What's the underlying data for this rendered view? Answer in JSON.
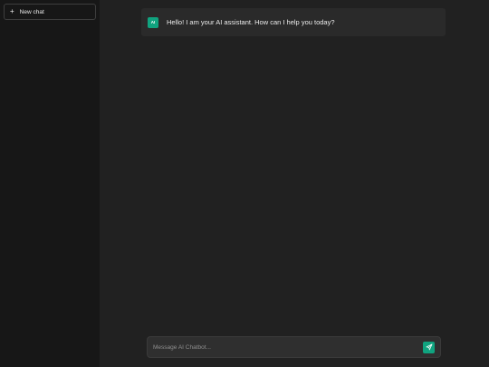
{
  "sidebar": {
    "new_chat": {
      "icon": "plus-icon",
      "label": "New chat"
    }
  },
  "conversation": {
    "messages": [
      {
        "role": "assistant",
        "avatar": "AI",
        "text": "Hello! I am your AI assistant. How can I help you today?"
      }
    ]
  },
  "composer": {
    "placeholder": "Message AI Chatbot...",
    "value": "",
    "send_icon": "send-icon"
  },
  "colors": {
    "accent": "#10a37f",
    "sidebar_bg": "#171717",
    "main_bg": "#212121",
    "message_bg": "#2a2a2a",
    "composer_bg": "#2f2f2f"
  }
}
